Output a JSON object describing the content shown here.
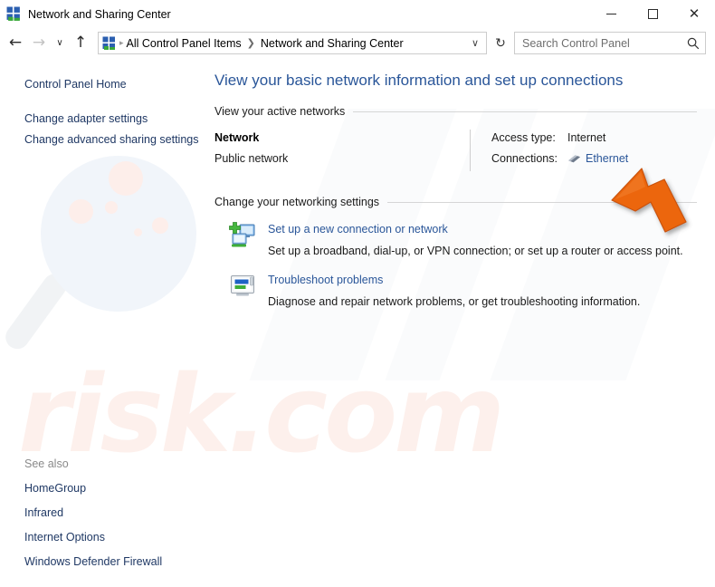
{
  "window": {
    "title": "Network and Sharing Center",
    "icon": "network-sharing-center-icon",
    "controls": {
      "minimize": "–",
      "maximize": "□",
      "close": "✕"
    }
  },
  "navbar": {
    "back_icon": "←",
    "forward_icon": "→",
    "recent_icon": "∨",
    "up_icon": "↑",
    "breadcrumb_icon": "network-sharing-center-icon",
    "breadcrumb_lead_sep": "▸",
    "breadcrumb": [
      "All Control Panel Items",
      "Network and Sharing Center"
    ],
    "breadcrumb_separator": "❯",
    "address_dropdown_icon": "∨",
    "refresh_icon": "↻",
    "search": {
      "placeholder": "Search Control Panel",
      "value": "",
      "icon": "search-icon"
    }
  },
  "sidebar": {
    "items": [
      {
        "label": "Control Panel Home"
      },
      {
        "label": "Change adapter settings"
      },
      {
        "label": "Change advanced sharing settings"
      }
    ],
    "see_also": {
      "label": "See also",
      "items": [
        {
          "label": "HomeGroup"
        },
        {
          "label": "Infrared"
        },
        {
          "label": "Internet Options"
        },
        {
          "label": "Windows Defender Firewall"
        }
      ]
    }
  },
  "main": {
    "page_title": "View your basic network information and set up connections",
    "active_networks": {
      "section_title": "View your active networks",
      "network_name": "Network",
      "network_type": "Public network",
      "access_type_label": "Access type:",
      "access_type_value": "Internet",
      "connections_label": "Connections:",
      "connection_link": "Ethernet",
      "connection_icon": "ethernet-cable-icon"
    },
    "networking_settings": {
      "section_title": "Change your networking settings",
      "items": [
        {
          "icon": "new-connection-icon",
          "link": "Set up a new connection or network",
          "description": "Set up a broadband, dial-up, or VPN connection; or set up a router or access point."
        },
        {
          "icon": "troubleshoot-icon",
          "link": "Troubleshoot problems",
          "description": "Diagnose and repair network problems, or get troubleshooting information."
        }
      ]
    }
  },
  "annotation": {
    "arrow_icon": "orange-pointer-arrow",
    "color": "#ec6608"
  },
  "watermark": {
    "text": "risk.com",
    "logo_icon": "magnifier-watermark-icon"
  },
  "colors": {
    "link": "#2a5699",
    "sidebar_link": "#1f3864",
    "accent_orange": "#ec6608",
    "window_bg": "#ffffff",
    "rule": "#d6d6d6"
  }
}
